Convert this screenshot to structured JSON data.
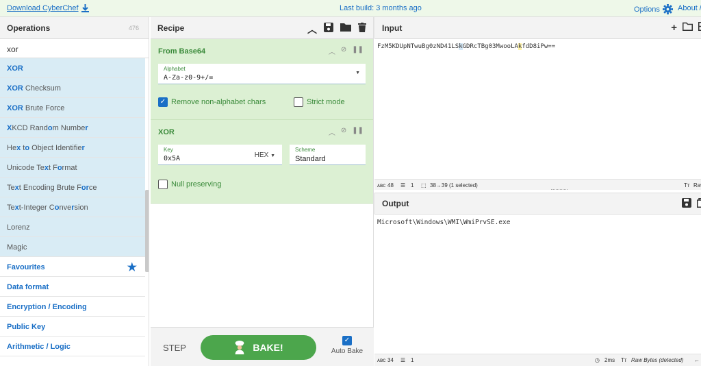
{
  "topbar": {
    "download": "Download CyberChef",
    "build": "Last build: 3 months ago",
    "options": "Options",
    "about": "About /"
  },
  "operations": {
    "title": "Operations",
    "count": "476",
    "search": "xor",
    "results": [
      {
        "pre": "",
        "hl": "XOR",
        "post": ""
      },
      {
        "pre": "",
        "hl": "XOR",
        "post": " Checksum"
      },
      {
        "pre": "",
        "hl": "XOR",
        "post": " Brute Force"
      },
      {
        "pre": "",
        "hl": "X",
        "post": "KCD Rand",
        "hl2": "o",
        "post2": "m Numbe",
        "hl3": "r",
        "post3": ""
      },
      {
        "pre": "He",
        "hl": "x",
        "post": " t",
        "hl2": "o",
        "post2": " Object Identifie",
        "hl3": "r",
        "post3": ""
      },
      {
        "pre": "Unicode Te",
        "hl": "x",
        "post": "t F",
        "hl2": "o",
        "post2": "rmat",
        "hl3": "",
        "post3": ""
      },
      {
        "pre": "Te",
        "hl": "x",
        "post": "t Encoding Brute F",
        "hl2": "o",
        "post2": "",
        "hl3": "r",
        "post3": "ce"
      },
      {
        "pre": "Te",
        "hl": "x",
        "post": "t-Integer C",
        "hl2": "o",
        "post2": "nve",
        "hl3": "r",
        "post3": "sion"
      },
      {
        "pre": "Lorenz",
        "hl": "",
        "post": ""
      },
      {
        "pre": "Magic",
        "hl": "",
        "post": ""
      }
    ],
    "categories": [
      "Favourites",
      "Data format",
      "Encryption / Encoding",
      "Public Key",
      "Arithmetic / Logic"
    ]
  },
  "recipe": {
    "title": "Recipe",
    "ops": [
      {
        "name": "From Base64",
        "alphabet_label": "Alphabet",
        "alphabet_value": "A-Za-z0-9+/=",
        "remove_label": "Remove non-alphabet chars",
        "strict_label": "Strict mode"
      },
      {
        "name": "XOR",
        "key_label": "Key",
        "key_value": "0x5A",
        "key_format": "HEX",
        "scheme_label": "Scheme",
        "scheme_value": "Standard",
        "null_label": "Null preserving"
      }
    ],
    "step": "STEP",
    "bake": "BAKE!",
    "autobake": "Auto Bake"
  },
  "input": {
    "title": "Input",
    "text_a": "FzM5KDUpNTwuBg0zND41LS",
    "text_b": "k",
    "text_c": "GDRcTBg03MwooLA",
    "text_d": "k",
    "text_e": "fdD8iPw==",
    "stat_len": "48",
    "stat_lines": "1",
    "stat_sel": "38→39 (1 selected)",
    "stat_right": "Raw"
  },
  "output": {
    "title": "Output",
    "text": "Microsoft\\Windows\\WMI\\WmiPrvSE.exe",
    "stat_len": "34",
    "stat_lines": "1",
    "stat_time": "2ms",
    "stat_enc": "Raw Bytes (detected)"
  }
}
